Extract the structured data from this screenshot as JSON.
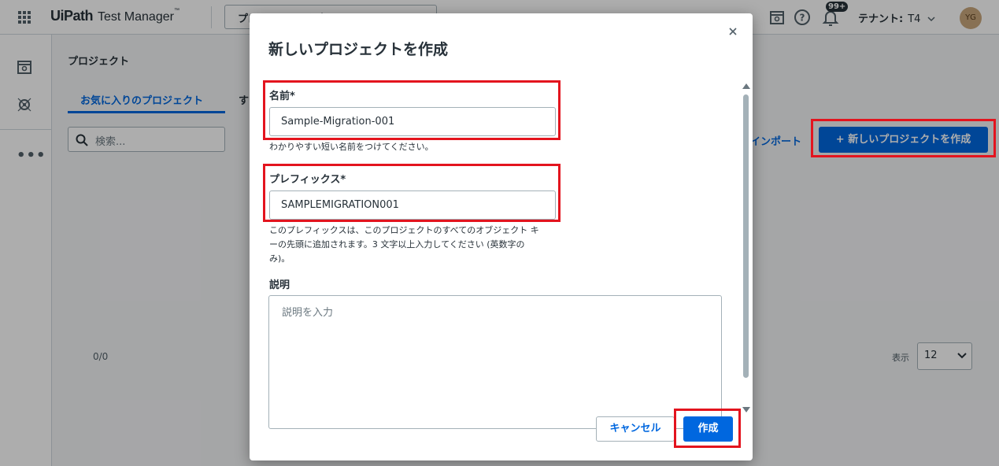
{
  "app": {
    "brand": "UiPath",
    "product": "Test Manager",
    "trademark": "™"
  },
  "topbar": {
    "project_select_label": "プロジェクトを選択",
    "notification_badge": "99+",
    "tenant_label": "テナント:",
    "tenant_value": "T4",
    "avatar_initials": "YG"
  },
  "page": {
    "title": "プロジェクト",
    "tabs": [
      {
        "label": "お気に入りのプロジェクト",
        "active": true
      },
      {
        "label": "す"
      }
    ],
    "search_placeholder": "検索...",
    "import_label": "インポート",
    "new_project_button": "+ 新しいプロジェクトを作成",
    "count": "0/0",
    "page_size_label": "表示",
    "page_size_value": "12"
  },
  "modal": {
    "title": "新しいプロジェクトを作成",
    "name_label": "名前*",
    "name_value": "Sample-Migration-001",
    "name_help": "わかりやすい短い名前をつけてください。",
    "prefix_label": "プレフィックス*",
    "prefix_value": "SAMPLEMIGRATION001",
    "prefix_help": "このプレフィックスは、このプロジェクトのすべてのオブジェクト キーの先頭に追加されます。3 文字以上入力してください (英数字のみ)。",
    "description_label": "説明",
    "description_placeholder": "説明を入力",
    "cancel_button": "キャンセル",
    "create_button": "作成"
  },
  "colors": {
    "accent": "#0067df",
    "highlight": "#e3141e",
    "text": "#273139"
  }
}
